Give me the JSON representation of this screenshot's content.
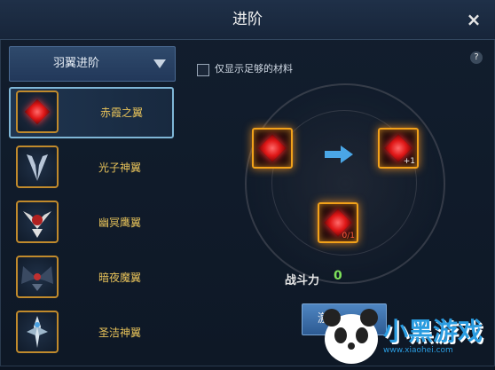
{
  "window": {
    "title": "进阶",
    "close_icon": "×"
  },
  "sidebar": {
    "dropdown_label": "羽翼进阶",
    "items": [
      {
        "label": "赤霞之翼",
        "icon": "red-gem-icon",
        "selected": true
      },
      {
        "label": "光子神翼",
        "icon": "silver-wing-icon",
        "selected": false
      },
      {
        "label": "幽冥鹰翼",
        "icon": "eagle-wing-icon",
        "selected": false
      },
      {
        "label": "暗夜魔翼",
        "icon": "dark-wing-icon",
        "selected": false
      },
      {
        "label": "圣洁神翼",
        "icon": "holy-wing-icon",
        "selected": false
      }
    ]
  },
  "main": {
    "filter_label": "仅显示足够的材料",
    "help": "?",
    "source_item": "red-gem-icon",
    "result_item": "red-gem-icon",
    "result_plus": "+1",
    "material_item": "red-gem-icon",
    "material_count": "0/1",
    "power_label": "战斗力",
    "power_value": "0",
    "activate_button": "激活"
  },
  "watermark": {
    "brand": "小黑游戏",
    "url": "www.xiaohei.com"
  },
  "colors": {
    "accent": "#e8c35a",
    "gold_border": "#f2a21a",
    "green": "#7ee25a",
    "button": "#3c70aa"
  }
}
